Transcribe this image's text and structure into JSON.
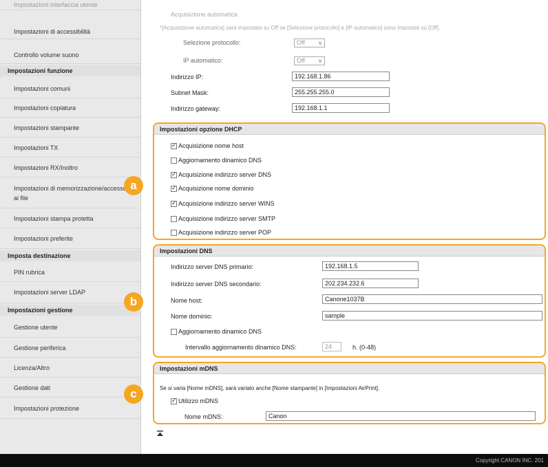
{
  "sidebar": {
    "items": [
      {
        "label": "Impostazioni interfaccia utente",
        "kind": "faded"
      },
      {
        "label": "Impostazioni di accessibilità",
        "kind": "item"
      },
      {
        "label": "Controllo volume suono",
        "kind": "item"
      },
      {
        "label": "Impostazioni funzione",
        "kind": "head"
      },
      {
        "label": "Impostazioni comuni",
        "kind": "item"
      },
      {
        "label": "Impostazioni copiatura",
        "kind": "item"
      },
      {
        "label": "Impostazioni stampante",
        "kind": "item"
      },
      {
        "label": "Impostazioni TX",
        "kind": "item"
      },
      {
        "label": "Impostazioni RX/Inoltro",
        "kind": "item"
      },
      {
        "label": "Impostazioni di memorizzazione/accesso ai file",
        "kind": "item"
      },
      {
        "label": "Impostazioni stampa protetta",
        "kind": "item"
      },
      {
        "label": "Impostazioni preferite",
        "kind": "item"
      },
      {
        "label": "Imposta destinazione",
        "kind": "head"
      },
      {
        "label": "PIN rubrica",
        "kind": "item"
      },
      {
        "label": "Impostazioni server LDAP",
        "kind": "item"
      },
      {
        "label": "Impostazioni gestione",
        "kind": "head"
      },
      {
        "label": "Gestione utente",
        "kind": "item"
      },
      {
        "label": "Gestione periferica",
        "kind": "item"
      },
      {
        "label": "Licenza/Altro",
        "kind": "item"
      },
      {
        "label": "Gestione dati",
        "kind": "item"
      },
      {
        "label": "Impostazioni protezione",
        "kind": "item"
      }
    ]
  },
  "ip": {
    "auto_title": "Acquisizione automatica",
    "auto_note": "*[Acquisizione automatica] sarà impostata su Off se [Selezione protocollo] e [IP automatico] sono impostati su [Off].",
    "protocol_label": "Selezione protocollo:",
    "protocol_value": "Off",
    "autoip_label": "IP automatico:",
    "autoip_value": "Off",
    "address_label": "Indirizzo IP:",
    "address_value": "192.168.1.86",
    "subnet_label": "Subnet Mask:",
    "subnet_value": "255.255.255.0",
    "gateway_label": "Indirizzo gateway:",
    "gateway_value": "192.168.1.1"
  },
  "dhcp": {
    "badge": "a",
    "title": "Impostazioni opzione DHCP",
    "options": [
      {
        "label": "Acquisizione nome host",
        "checked": true
      },
      {
        "label": "Aggiornamento dinamico DNS",
        "checked": false
      },
      {
        "label": "Acquisizione indirizzo server DNS",
        "checked": true
      },
      {
        "label": "Acquisizione nome dominio",
        "checked": true
      },
      {
        "label": "Acquisizione indirizzo server WINS",
        "checked": true
      },
      {
        "label": "Acquisizione indirizzo server SMTP",
        "checked": false
      },
      {
        "label": "Acquisizione indirizzo server POP",
        "checked": false
      }
    ]
  },
  "dns": {
    "badge": "b",
    "title": "Impostazioni DNS",
    "primary_label": "Indirizzo server DNS primario:",
    "primary_value": "192.168.1.5",
    "secondary_label": "Indirizzo server DNS secondario:",
    "secondary_value": "202.234.232.6",
    "host_label": "Nome host:",
    "host_value": "Canone1037B",
    "domain_label": "Nome dominio:",
    "domain_value": "sample",
    "dynamic_label": "Aggiornamento dinamico DNS",
    "dynamic_checked": false,
    "interval_label": "Intervallo aggiornamento dinamico DNS:",
    "interval_value": "24",
    "interval_unit": "h. (0-48)"
  },
  "mdns": {
    "badge": "c",
    "title": "Impostazioni mDNS",
    "note": "Se si varia [Nome mDNS], sarà variato anche [Nome stampante] in [Impostazioni AirPrint].",
    "use_label": "Utilizzo mDNS",
    "use_checked": true,
    "name_label": "Nome mDNS:",
    "name_value": "Canon"
  },
  "page_top_icon": "to-top-icon",
  "footer": {
    "copyright": "Copyright CANON INC. 201"
  },
  "colors": {
    "accent": "#f5a623",
    "sidebar_bg": "#e9e9e9",
    "footer_bg": "#0d0d0d"
  }
}
